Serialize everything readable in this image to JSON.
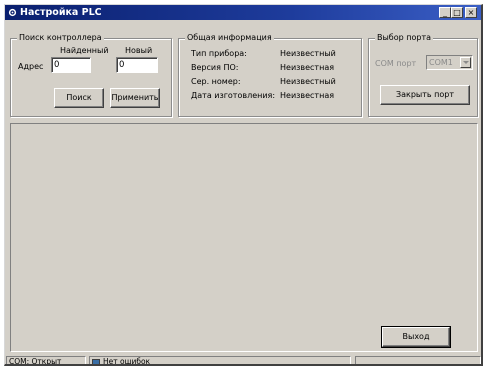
{
  "window": {
    "title": "Настройка PLC",
    "controls": {
      "minimize": "_",
      "maximize": "□",
      "close": "×"
    }
  },
  "search_group": {
    "label": "Поиск контроллера",
    "found_label": "Найденный",
    "new_label": "Новый",
    "address_label": "Адрес",
    "found_value": "0",
    "new_value": "0",
    "search_button": "Поиск",
    "apply_button": "Применить"
  },
  "info_group": {
    "label": "Общая информация",
    "rows": [
      {
        "key": "Тип прибора:",
        "value": "Неизвестный"
      },
      {
        "key": "Версия ПО:",
        "value": "Неизвестная"
      },
      {
        "key": "Сер. номер:",
        "value": "Неизвестный"
      },
      {
        "key": "Дата изготовления:",
        "value": "Неизвестная"
      }
    ]
  },
  "port_group": {
    "label": "Выбор порта",
    "com_label": "COM порт",
    "com_value": "COM1",
    "close_button": "Закрыть порт"
  },
  "exit_button": "Выход",
  "status": {
    "port": "COM: Открыт",
    "errors": "Нет ошибок"
  },
  "colors": {
    "title_start": "#0a1f6e",
    "title_end": "#3b5fc6",
    "face": "#d4d0c8"
  },
  "icons": {
    "app": "gear-icon"
  }
}
